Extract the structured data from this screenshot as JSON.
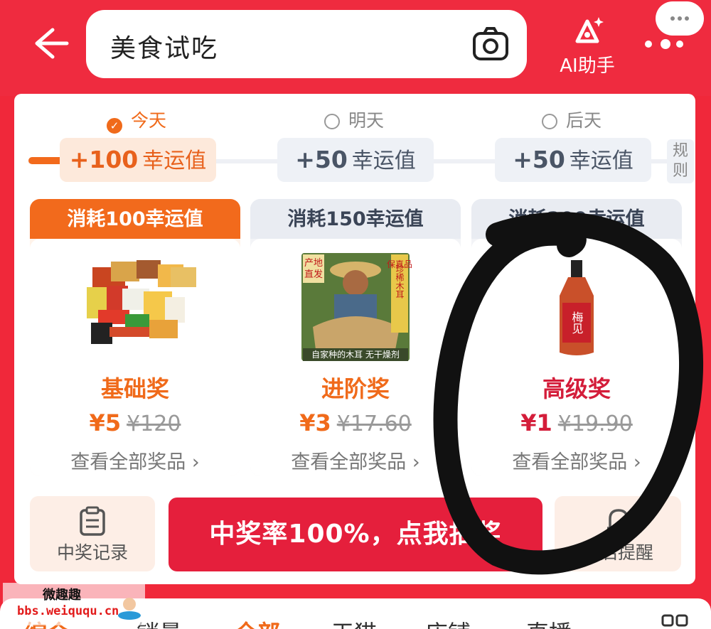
{
  "header": {
    "search_text": "美食试吃",
    "ai_label": "AI助手"
  },
  "days": [
    {
      "label": "今天",
      "active": true
    },
    {
      "label": "明天",
      "active": false
    },
    {
      "label": "后天",
      "active": false
    }
  ],
  "luck": [
    {
      "value": "+100",
      "unit": "幸运值"
    },
    {
      "value": "+50",
      "unit": "幸运值"
    },
    {
      "value": "+50",
      "unit": "幸运值"
    }
  ],
  "rule_label": "规则",
  "cards": [
    {
      "head": "消耗100幸运值",
      "tier": "基础奖",
      "price": "¥5",
      "was": "¥120",
      "view": "查看全部奖品 ›"
    },
    {
      "head": "消耗150幸运值",
      "tier": "进阶奖",
      "price": "¥3",
      "was": "¥17.60",
      "view": "查看全部奖品 ›",
      "img_text": [
        "产地",
        "直发",
        "保真品",
        "珍稀木耳",
        "自家种的木耳 无干燥剂"
      ]
    },
    {
      "head": "消耗200幸运值",
      "tier": "高级奖",
      "price": "¥1",
      "was": "¥19.90",
      "view": "查看全部奖品 ›",
      "img_text": [
        "梅见"
      ]
    }
  ],
  "actions": {
    "record_label": "中奖记录",
    "draw_label": "中奖率100%，点我抽奖",
    "remind_label": "开启提醒"
  },
  "bottom_tabs": [
    "综合",
    "销量",
    "全部",
    "天猫",
    "店铺",
    "直播"
  ],
  "watermark": {
    "line1": "微趣趣",
    "line2": "bbs.weiququ.cn"
  },
  "colors": {
    "brand_red": "#ef2b3f",
    "orange": "#f06a1a",
    "draw_red": "#e51f3c"
  }
}
